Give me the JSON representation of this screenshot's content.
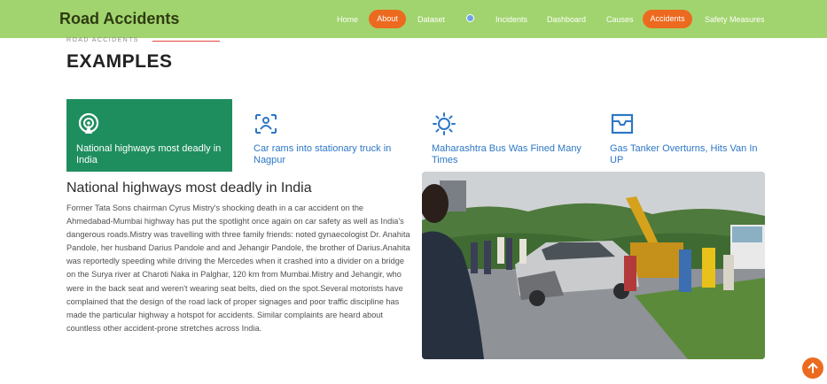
{
  "brand": {
    "title": "Road Accidents"
  },
  "nav": {
    "items": [
      "Home",
      "About",
      "Dataset",
      "Incidents",
      "Dashboard",
      "Causes",
      "Accidents",
      "Safety Measures"
    ],
    "active": [
      "About",
      "Accidents"
    ],
    "colors": {
      "bar": "#a1d46e",
      "pill": "#ec6a1f"
    }
  },
  "section": {
    "eyebrow": "ROAD ACCIDENTS",
    "title": "EXAMPLES"
  },
  "tabs": [
    {
      "label": "National highways most deadly in India",
      "icon": "signal-icon",
      "active": true
    },
    {
      "label": "Car rams into stationary truck in Nagpur",
      "icon": "people-icon",
      "active": false
    },
    {
      "label": "Maharashtra Bus Was Fined Many Times",
      "icon": "sun-icon",
      "active": false
    },
    {
      "label": "Gas Tanker Overturns, Hits Van In UP",
      "icon": "box-icon",
      "active": false
    }
  ],
  "article": {
    "title": "National highways most deadly in India",
    "body": "Former Tata Sons chairman Cyrus Mistry's shocking death in a car accident on the Ahmedabad-Mumbai highway has put the spotlight once again on car safety as well as India's dangerous roads.Mistry was travelling with three family friends: noted gynaecologist Dr. Anahita Pandole, her husband Darius Pandole and and Jehangir Pandole, the brother of Darius.Anahita was reportedly speeding while driving the Mercedes when it crashed into a divider on a bridge on the Surya river at Charoti Naka in Palghar, 120 km from Mumbai.Mistry and Jehangir, who were in the back seat and weren't wearing seat belts, died on the spot.Several motorists have complained that the design of the road lack of proper signages and poor traffic discipline has made the particular highway a hotspot for accidents. Similar complaints are heard about countless other accident-prone stretches across India."
  },
  "photo": {
    "subject": "crashed-car-scene"
  },
  "accent": {
    "tab_active": "#1f8e5f",
    "link": "#2d77c6",
    "eyebrow_line": "#e0473d"
  }
}
